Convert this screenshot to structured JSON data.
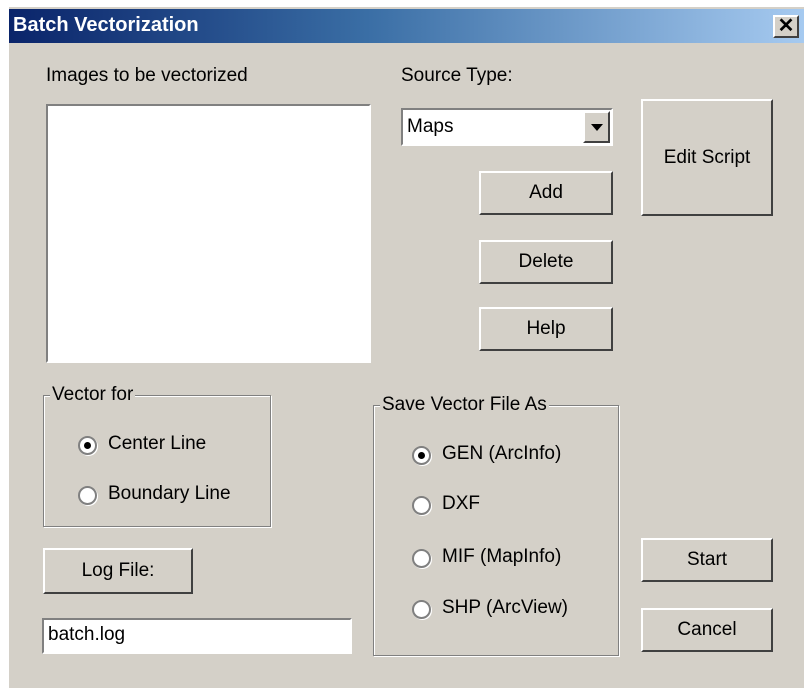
{
  "window": {
    "title": "Batch Vectorization",
    "close_symbol": "✕"
  },
  "images": {
    "label": "Images to be vectorized",
    "items": []
  },
  "source_type": {
    "label": "Source Type:",
    "selected": "Maps"
  },
  "buttons": {
    "edit_script": "Edit Script",
    "add": "Add",
    "delete": "Delete",
    "help": "Help",
    "log_file": "Log File:",
    "start": "Start",
    "cancel": "Cancel"
  },
  "vector_for": {
    "title": "Vector for",
    "options": [
      "Center Line",
      "Boundary Line"
    ],
    "selected": 0
  },
  "save_as": {
    "title": "Save Vector File As",
    "options": [
      "GEN (ArcInfo)",
      "DXF",
      "MIF (MapInfo)",
      "SHP (ArcView)"
    ],
    "selected": 0
  },
  "log_file": {
    "value": "batch.log"
  }
}
